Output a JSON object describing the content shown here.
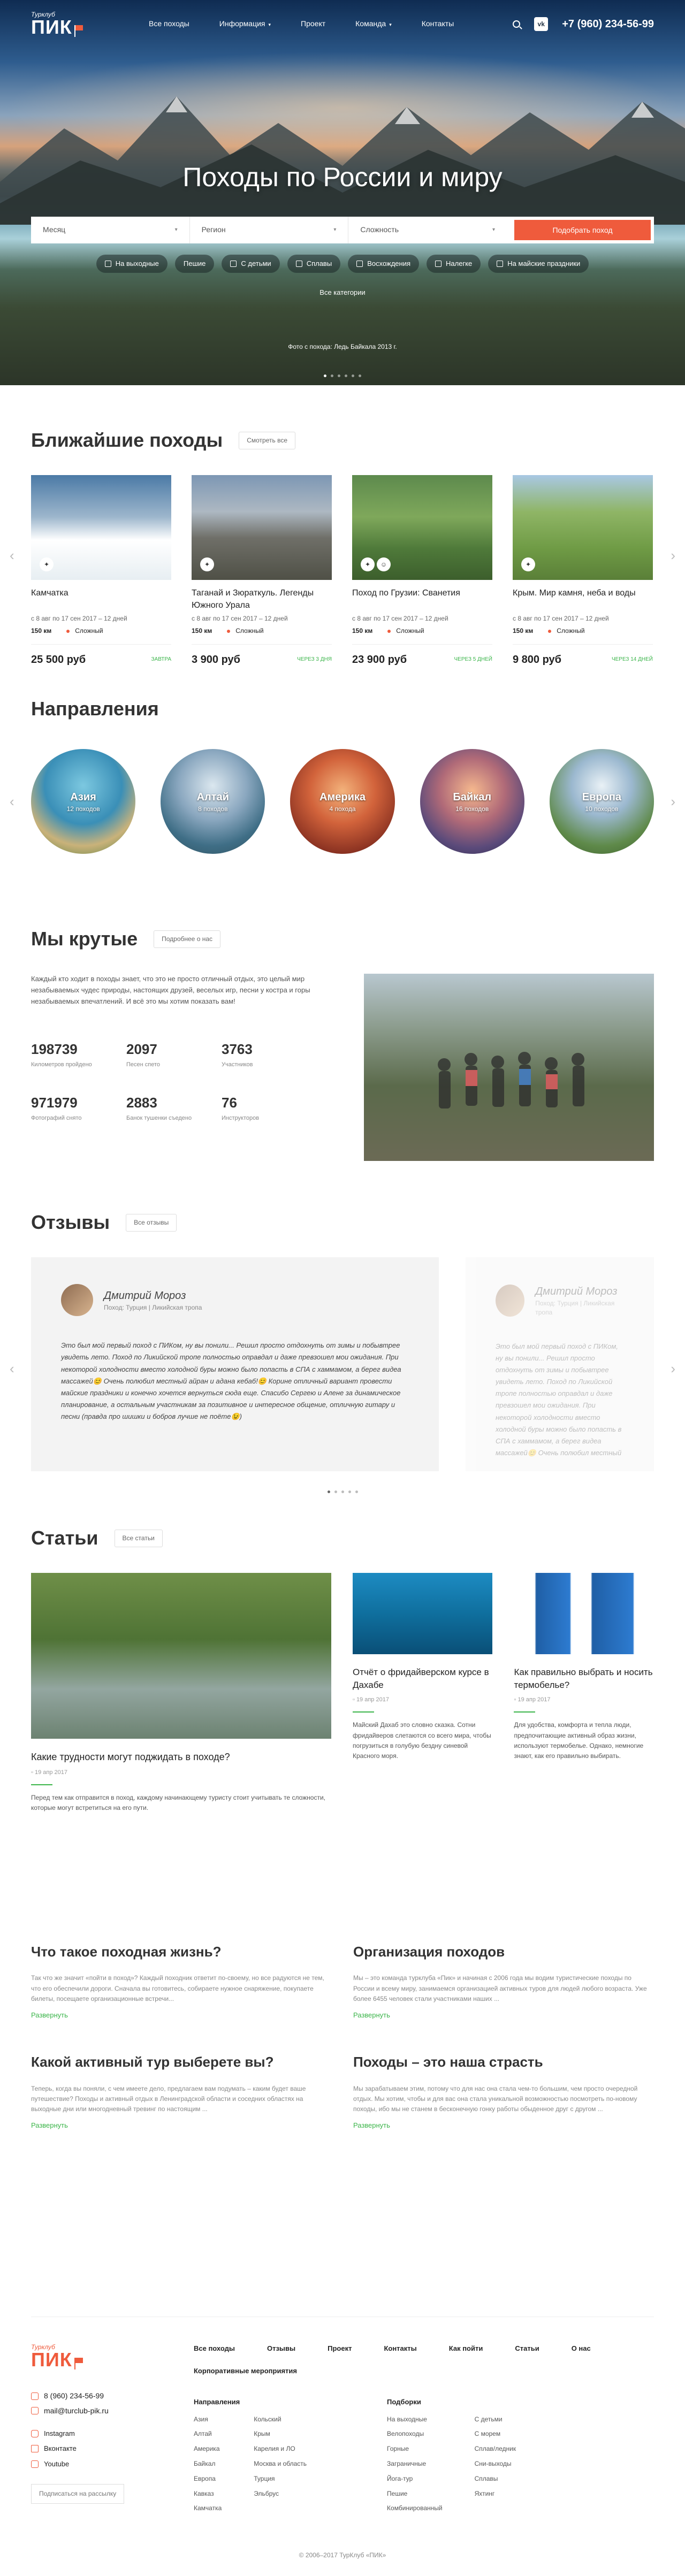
{
  "header": {
    "logo_small": "Турклуб",
    "logo_big": "ПИК",
    "nav": [
      {
        "label": "Все походы",
        "caret": false
      },
      {
        "label": "Информация",
        "caret": true
      },
      {
        "label": "Проект",
        "caret": false
      },
      {
        "label": "Команда",
        "caret": true
      },
      {
        "label": "Контакты",
        "caret": false
      }
    ],
    "vk": "vk",
    "phone": "+7 (960) 234-56-99"
  },
  "hero": {
    "title": "Походы по России и миру",
    "search": {
      "month": "Месяц",
      "region": "Регион",
      "difficulty": "Сложность",
      "button": "Подобрать поход"
    },
    "categories": [
      "На выходные",
      "Пешие",
      "С детьми",
      "Сплавы",
      "Восхождения",
      "Налегке",
      "На майские праздники"
    ],
    "all_categories": "Все категории",
    "caption": "Фото с похода: Ледь Байкала 2013 г."
  },
  "trips": {
    "title": "Ближайшие походы",
    "all_button": "Смотреть все",
    "items": [
      {
        "title": "Камчатка",
        "dates": "с 8 авг по 17 сен 2017 – 12 дней",
        "distance": "150 км",
        "difficulty": "Сложный",
        "price": "25 500 руб",
        "when": "ЗАВТРА"
      },
      {
        "title": "Таганай и Зюраткуль. Легенды Южного Урала",
        "dates": "с 8 авг по 17 сен 2017 – 12 дней",
        "distance": "150 км",
        "difficulty": "Сложный",
        "price": "3 900 руб",
        "when": "ЧЕРЕЗ 3 ДНЯ"
      },
      {
        "title": "Поход по Грузии: Сванетия",
        "dates": "с 8 авг по 17 сен 2017 – 12 дней",
        "distance": "150 км",
        "difficulty": "Сложный",
        "price": "23 900 руб",
        "when": "ЧЕРЕЗ 5 ДНЕЙ"
      },
      {
        "title": "Крым. Мир камня, неба и воды",
        "dates": "с 8 авг по 17 сен 2017 – 12 дней",
        "distance": "150 км",
        "difficulty": "Сложный",
        "price": "9 800 руб",
        "when": "ЧЕРЕЗ 14 ДНЕЙ"
      }
    ]
  },
  "directions": {
    "title": "Направления",
    "items": [
      {
        "name": "Азия",
        "count": "12 походов"
      },
      {
        "name": "Алтай",
        "count": "8 походов"
      },
      {
        "name": "Америка",
        "count": "4 похода"
      },
      {
        "name": "Байкал",
        "count": "16 походов"
      },
      {
        "name": "Европа",
        "count": "10 походов"
      }
    ]
  },
  "about": {
    "title": "Мы крутые",
    "button": "Подробнее о нас",
    "text": "Каждый кто ходит в походы знает, что это не просто отличный отдых, это целый мир незабываемых чудес природы, настоящих друзей, веселых игр, песни у костра и горы незабываемых впечатлений. И всё это мы хотим показать вам!",
    "stats": [
      {
        "value": "198739",
        "label": "Километров пройдено"
      },
      {
        "value": "2097",
        "label": "Песен спето"
      },
      {
        "value": "3763",
        "label": "Участников"
      },
      {
        "value": "971979",
        "label": "Фотографий снято"
      },
      {
        "value": "2883",
        "label": "Банок тушенки съедено"
      },
      {
        "value": "76",
        "label": "Инструкторов"
      }
    ]
  },
  "reviews": {
    "title": "Отзывы",
    "button": "Все отзывы",
    "items": [
      {
        "name": "Дмитрий Мороз",
        "trip_label": "Поход:",
        "trip": "Турция | Ликийская тропа",
        "text": "Это был мой первый поход с ПИКом, ну вы понили... Решил просто отдохнуть от зимы и побывтрее увидеть лето. Поход по Ликийской тропе полностью оправдал и даже превзошел мои ожидания. При некоторой холодности вместо холодной буры можно было попасть в СПА с хаммамом, а берег видеа массажей😊 Очень полюбил местный айран и адана кебаб!😊 Корине отличный вариант провести майские праздники и конечно хочется вернуться сюда еще. Спасибо Сергею и Алене за динамическое планирование, а остальным участникам за позитивное и интересное общение, отличную гитару и песни (правда про шишки и бобров лучше не поёте😉)"
      },
      {
        "name": "Дмитрий Мороз",
        "trip_label": "Поход:",
        "trip": "Турция | Ликийская тропа",
        "text": "Это был мой первый поход с ПИКом, ну вы понили... Решил просто отдохнуть от зимы и побывтрее увидеть лето. Поход по Ликийской тропе полностью оправдал и даже превзошел мои ожидания. При некоторой холодности вместо холодной буры можно было попасть в СПА с хаммамом, а берег видеа массажей😊 Очень полюбил местный айран и адана кебаб!😊 Корине отличный вариант провести майские праздники и конечно хочется вернуться сюда еще. Спасибо Сергею и Алене за динамическое планирование, а остальным участникам за позитивное и интересное общение, отличную гитару и песни (правда про шишки и бобров лучше не поёте😉)"
      }
    ]
  },
  "articles": {
    "title": "Статьи",
    "button": "Все статьи",
    "items": [
      {
        "title": "Какие трудности могут поджидать в походе?",
        "date": "19 апр 2017",
        "text": "Перед тем как отправится в поход, каждому начинающему туристу стоит учитывать те сложности, которые могут встретиться на его пути."
      },
      {
        "title": "Отчёт о фридайверском курсе в Дахабе",
        "date": "19 апр 2017",
        "text": "Майский Дахаб это словно сказка. Сотни фридайверов слетаются со всего мира, чтобы погрузиться в голубую бездну синевой Красного моря."
      },
      {
        "title": "Как правильно выбрать и носить термобелье?",
        "date": "19 апр 2017",
        "text": "Для удобства, комфорта и теплa люди, предпочитающие активный образ жизни, используют термобелье. Однако, немногие знают, как его правильно выбирать."
      }
    ]
  },
  "textblocks": [
    {
      "title": "Что такое походная жизнь?",
      "text": "Так что же значит «пойти в поход»? Каждый походник ответит по-своему, но все радуются не тем, что его обеспечили дороги. Сначала вы готовитесь, собираете нужное снаряжение, покупаете билеты, посещаете организационные встречи...",
      "link": "Развернуть"
    },
    {
      "title": "Организация походов",
      "text": "Мы – это команда турклуба «Пик» и начиная с 2006 года мы водим туристические походы по России и всему миру, занимаемся организацией активных туров для людей любого возраста. Уже более 6455 человек стали участниками наших ...",
      "link": "Развернуть"
    },
    {
      "title": "Какой активный тур выберете вы?",
      "text": "Теперь, когда вы поняли, с чем имеете дело, предлагаем вам подумать – каким будет ваше путешествие? Походы и активный отдых в Ленинградской области и соседних областях на выходные дни или многодневный тревинг по настоящим ...",
      "link": "Развернуть"
    },
    {
      "title": "Походы – это наша страсть",
      "text": "Мы зарабатываем этим, потому что для нас она стала чем-то большим, чем просто очередной отдых. Мы хотим, чтобы и для вас она стала уникальной возможностью посмотреть по-новому походы, ибо мы не станем в бесконечную гонку работы обыденное друг с другом ...",
      "link": "Развернуть"
    }
  ],
  "footer": {
    "logo_small": "Турклуб",
    "logo_big": "ПИК",
    "phone": "8 (960) 234-56-99",
    "email": "mail@turclub-pik.ru",
    "social": [
      "Instagram",
      "Вконтакте",
      "Youtube"
    ],
    "subscribe": "Подписаться на рассылку",
    "menu": [
      "Все походы",
      "Отзывы",
      "Проект",
      "Контакты",
      "Как пойти",
      "Статьи",
      "О нас",
      "Корпоративные мероприятия"
    ],
    "directions_title": "Направления",
    "directions_a": [
      "Азия",
      "Алтай",
      "Америка",
      "Байкал",
      "Европа",
      "Кавказ",
      "Камчатка"
    ],
    "directions_b": [
      "Кольский",
      "Крым",
      "Карелия и ЛО",
      "Москва и область",
      "Турция",
      "Эльбрус"
    ],
    "kinds_title": "Подборки",
    "kinds_a": [
      "На выходные",
      "Велопоходы",
      "Горные",
      "Заграничные",
      "Йога-тур",
      "Пешие",
      "Комбинированный"
    ],
    "kinds_b": [
      "С детьми",
      "С морем",
      "Сплав/ледник",
      "Сни-выходы",
      "Сплавы",
      "Яхтинг"
    ],
    "copyright": "© 2006–2017 ТурКлуб «ПИК»"
  }
}
